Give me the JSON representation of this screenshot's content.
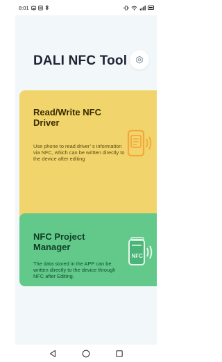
{
  "status_bar": {
    "time": "8:01",
    "left_icons": [
      "image-icon",
      "gallery-icon",
      "bluetooth-icon"
    ],
    "right_icons": [
      "vibrate-icon",
      "wifi-icon",
      "signal-icon",
      "battery-icon"
    ]
  },
  "header": {
    "title": "DALI NFC Tool",
    "settings_icon": "settings-icon"
  },
  "cards": [
    {
      "title": "Read/Write NFC Driver",
      "description": "Use phone to read driver’ s information via NFC, which can be written directly to the device after editing",
      "icon": "phone-nfc-icon",
      "color": "#f1d56c"
    },
    {
      "title": "NFC Project Manager",
      "description": "The data stored in the APP can be written directly to the device through NFC after Editing.",
      "icon": "nfc-card-icon",
      "color": "#62c98a"
    }
  ],
  "nav_bar": {
    "back_icon": "back-triangle-icon",
    "home_icon": "home-circle-icon",
    "recents_icon": "recents-square-icon"
  }
}
